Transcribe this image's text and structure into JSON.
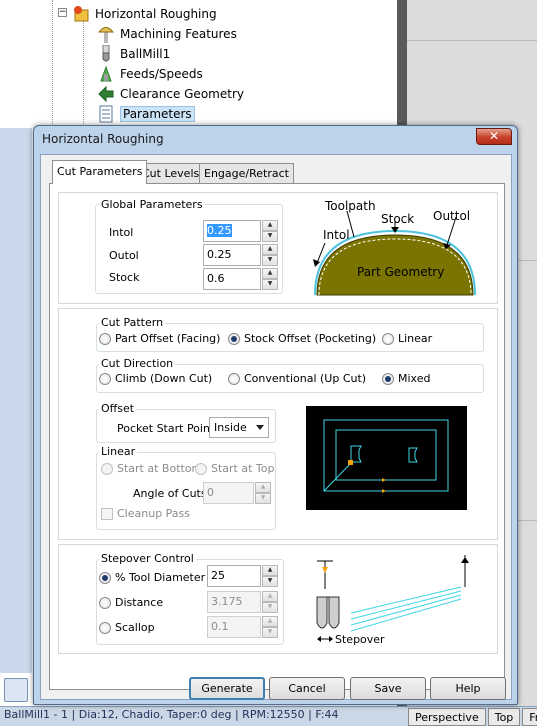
{
  "tree": {
    "items": [
      {
        "label": "Horizontal Roughing",
        "icon": "operation-icon"
      },
      {
        "label": "Machining Features",
        "icon": "features-icon"
      },
      {
        "label": "BallMill1",
        "icon": "ballmill-icon"
      },
      {
        "label": "Feeds/Speeds",
        "icon": "feeds-speeds-icon"
      },
      {
        "label": "Clearance Geometry",
        "icon": "clearance-icon"
      },
      {
        "label": "Parameters",
        "icon": "parameters-icon"
      }
    ]
  },
  "status_bar": {
    "text": "BallMill1 - 1 | Dia:12, Chadio, Taper:0 deg | RPM:12550 | F:44"
  },
  "view_tabs": [
    "Perspective",
    "Top",
    "Fr"
  ],
  "dialog": {
    "title": "Horizontal Roughing",
    "close_symbol": "✕",
    "tabs": [
      "Cut Parameters",
      "Cut Levels",
      "Engage/Retract"
    ],
    "active_tab": "Cut Parameters",
    "global_parameters": {
      "title": "Global Parameters",
      "intol_label": "Intol",
      "intol_value": "0.25",
      "outol_label": "Outol",
      "outol_value": "0.25",
      "stock_label": "Stock",
      "stock_value": "0.6"
    },
    "tolerance_diagram": {
      "toolpath": "Toolpath",
      "stock": "Stock",
      "outtol": "Outtol",
      "intol": "Intol",
      "part_geometry": "Part Geometry"
    },
    "cut_pattern": {
      "title": "Cut Pattern",
      "options": [
        "Part Offset (Facing)",
        "Stock Offset (Pocketing)",
        "Linear"
      ],
      "selected": "Stock Offset (Pocketing)"
    },
    "cut_direction": {
      "title": "Cut Direction",
      "options": [
        "Climb (Down Cut)",
        "Conventional (Up Cut)",
        "Mixed"
      ],
      "selected": "Mixed"
    },
    "offset": {
      "title": "Offset",
      "pocket_start_label": "Pocket Start Point",
      "pocket_start_value": "Inside"
    },
    "linear": {
      "title": "Linear",
      "start_bottom": "Start at Bottom",
      "start_top": "Start at Top",
      "angle_label": "Angle of Cuts",
      "angle_value": "0",
      "cleanup_label": "Cleanup Pass"
    },
    "stepover": {
      "title": "Stepover Control",
      "options": [
        {
          "label": "% Tool Diameter",
          "value": "25"
        },
        {
          "label": "Distance",
          "value": "3.175"
        },
        {
          "label": "Scallop",
          "value": "0.1"
        }
      ],
      "selected": "% Tool Diameter",
      "diagram_label": "Stepover"
    },
    "buttons": {
      "generate": "Generate",
      "cancel": "Cancel",
      "save": "Save",
      "help": "Help"
    }
  },
  "colors": {
    "part_geometry_fill": "#7c7400",
    "toolpath_line": "#4fc3dc",
    "preview_bg": "#000000",
    "preview_path": "#3fd6e6",
    "preview_marker": "#f5a100"
  }
}
